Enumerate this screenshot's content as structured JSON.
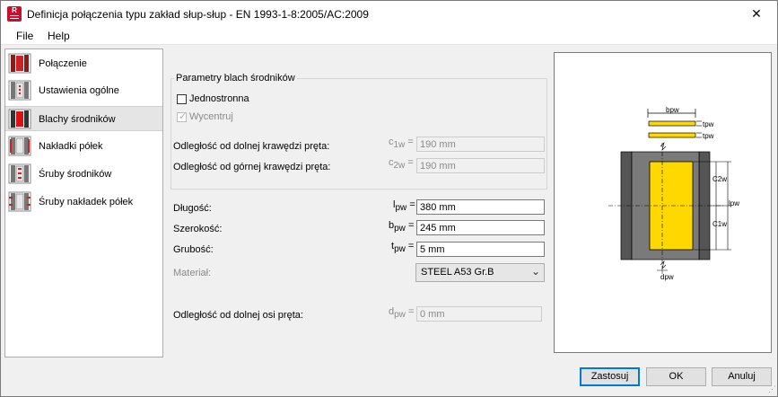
{
  "window": {
    "title": "Definicja połączenia typu zakład słup-słup - EN 1993-1-8:2005/AC:2009",
    "app_icon_letter": "R",
    "close_glyph": "✕"
  },
  "menu": [
    "File",
    "Help"
  ],
  "nav": {
    "items": [
      {
        "label": "Połączenie",
        "icon": "connection-icon"
      },
      {
        "label": "Ustawienia ogólne",
        "icon": "general-settings-icon"
      },
      {
        "label": "Blachy środników",
        "icon": "web-plates-icon",
        "selected": true
      },
      {
        "label": "Nakładki półek",
        "icon": "flange-covers-icon"
      },
      {
        "label": "Śruby środników",
        "icon": "web-bolts-icon"
      },
      {
        "label": "Śruby nakładek półek",
        "icon": "flange-cover-bolts-icon"
      }
    ]
  },
  "form": {
    "group_title": "Parametry blach środników",
    "one_sided": {
      "label": "Jednostronna",
      "checked": false
    },
    "center": {
      "label": "Wycentruj",
      "checked": true,
      "disabled": true
    },
    "dist_bottom_edge": {
      "label": "Odległość od dolnej krawędzi pręta:",
      "sym": "c",
      "sub": "1w",
      "eq": "=",
      "value": "190 mm",
      "disabled": true
    },
    "dist_top_edge": {
      "label": "Odległość od górnej krawędzi pręta:",
      "sym": "c",
      "sub": "2w",
      "eq": "=",
      "value": "190 mm",
      "disabled": true
    },
    "length": {
      "label": "Długość:",
      "sym": "l",
      "sub": "pw",
      "eq": "=",
      "value": "380 mm"
    },
    "width": {
      "label": "Szerokość:",
      "sym": "b",
      "sub": "pw",
      "eq": "=",
      "value": "245 mm"
    },
    "thickness": {
      "label": "Grubość:",
      "sym": "t",
      "sub": "pw",
      "eq": "=",
      "value": "5 mm"
    },
    "material": {
      "label": "Materiał:",
      "value": "STEEL A53 Gr.B"
    },
    "dist_bottom_axis": {
      "label": "Odległość od dolnej osi pręta:",
      "sym": "d",
      "sub": "pw",
      "eq": "=",
      "value": "0 mm",
      "disabled": true
    }
  },
  "preview": {
    "labels": {
      "bpw": "bpw",
      "tpw": "tpw",
      "tpw2": "tpw",
      "c2w": "C2w",
      "c1w": "C1w",
      "lpw": "lpw",
      "dpw": "dpw"
    },
    "colors": {
      "plate": "#ffd800",
      "column": "#555555",
      "flange": "#7a7a7a"
    }
  },
  "buttons": {
    "apply": "Zastosuj",
    "ok": "OK",
    "cancel": "Anuluj"
  }
}
